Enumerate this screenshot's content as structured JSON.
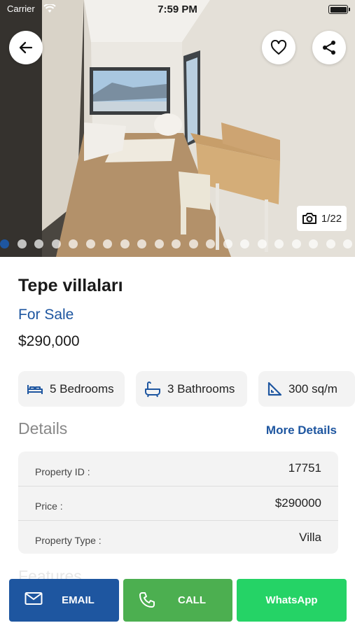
{
  "status_bar": {
    "carrier": "Carrier",
    "time": "7:59 PM"
  },
  "gallery": {
    "counter": "1/22",
    "dot_count": 21,
    "active_dot": 0
  },
  "actions_top": {
    "back_icon": "arrow-left-icon",
    "favorite_icon": "heart-icon",
    "share_icon": "share-icon"
  },
  "property": {
    "title": "Tepe villaları",
    "listing_status": "For Sale",
    "price": "$290,000"
  },
  "features_chips": [
    {
      "icon": "bed-icon",
      "label": "5  Bedrooms"
    },
    {
      "icon": "bath-icon",
      "label": "3  Bathrooms"
    },
    {
      "icon": "area-icon",
      "label": "300  sq/m"
    }
  ],
  "details": {
    "heading": "Details",
    "more_link": "More Details",
    "rows": [
      {
        "label": "Property ID :",
        "value": "17751"
      },
      {
        "label": "Price :",
        "value": "$290000"
      },
      {
        "label": "Property Type :",
        "value": "Villa"
      }
    ]
  },
  "features_heading": "Features",
  "bottom_actions": {
    "email": "EMAIL",
    "call": "CALL",
    "whatsapp": "WhatsApp"
  },
  "colors": {
    "primary": "#1e56a0",
    "call_green": "#4caf50",
    "whatsapp_green": "#25d366"
  }
}
